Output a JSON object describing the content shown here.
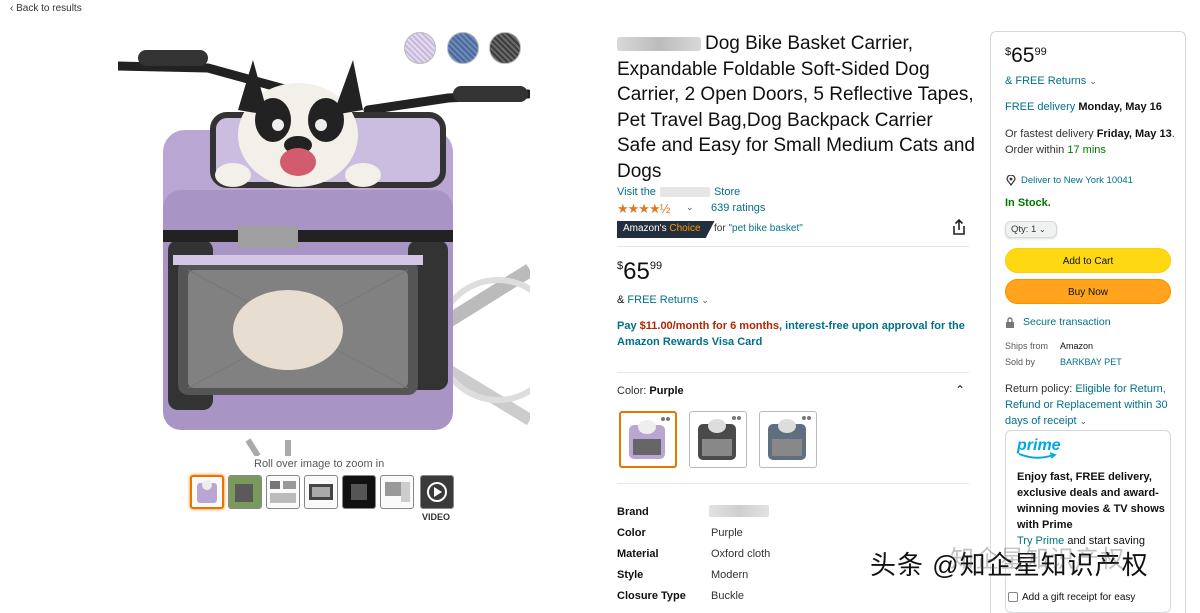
{
  "nav": {
    "back": "‹ Back to results"
  },
  "gallery": {
    "zoom_hint": "Roll over image to zoom in",
    "video_label": "VIDEO",
    "swatch_colors": [
      "#c9b7dc",
      "#4a6a9a",
      "#3d3d3d"
    ]
  },
  "product": {
    "title": "Dog Bike Basket Carrier, Expandable Foldable Soft-Sided Dog Carrier, 2 Open Doors, 5 Reflective Tapes, Pet Travel Bag,Dog Backpack Carrier Safe and Easy for Small Medium Cats and Dogs",
    "visit_prefix": "Visit the",
    "visit_suffix": "Store",
    "stars": "★★★★½",
    "ratings": "639 ratings",
    "badge_amazons": "Amazon's",
    "badge_choice": "Choice",
    "choice_for": "for",
    "choice_term": "\"pet bike basket\"",
    "price_symbol": "$",
    "price_whole": "65",
    "price_fraction": "99",
    "free_returns": "FREE Returns",
    "pay_prefix": "Pay ",
    "pay_amount": "$11.00/month for 6 months",
    "pay_suffix": ", interest-free upon approval for the Amazon Rewards Visa Card",
    "color_label": "Color: ",
    "color_value": "Purple"
  },
  "specs": [
    {
      "key": "Brand",
      "value": ""
    },
    {
      "key": "Color",
      "value": "Purple"
    },
    {
      "key": "Material",
      "value": "Oxford cloth"
    },
    {
      "key": "Style",
      "value": "Modern"
    },
    {
      "key": "Closure Type",
      "value": "Buckle"
    }
  ],
  "buybox": {
    "price_symbol": "$",
    "price_whole": "65",
    "price_fraction": "99",
    "returns": "& FREE Returns",
    "delivery_prefix": "FREE delivery ",
    "delivery_date": "Monday, May 16",
    "fastest_prefix": "Or fastest delivery ",
    "fastest_date": "Friday, May 13",
    "fastest_mid": ". Order within ",
    "fastest_time": "17 mins",
    "deliver_to": "Deliver to New York 10041",
    "stock": "In Stock.",
    "qty": "Qty: 1",
    "add_to_cart": "Add to Cart",
    "buy_now": "Buy Now",
    "secure": "Secure transaction",
    "ships_from_label": "Ships from",
    "ships_from": "Amazon",
    "sold_by_label": "Sold by",
    "sold_by": "BARKBAY PET",
    "return_prefix": "Return policy: ",
    "return_link": "Eligible for Return, Refund or Replacement within 30 days of receipt",
    "prime_logo": "prime",
    "prime_text": "Enjoy fast, FREE delivery, exclusive deals and award-winning movies & TV shows with Prime",
    "prime_try": "Try Prime",
    "prime_try_suffix": " and start saving",
    "gift": "Add a gift receipt for easy"
  },
  "watermark": {
    "main": "头条 @知企星知识产权",
    "faint": "知企星知识产权"
  },
  "colors": {
    "link": "#007185",
    "add_to_cart": "#ffd814",
    "buy_now": "#ffa41c",
    "in_stock": "#007600",
    "star": "#de7921"
  }
}
